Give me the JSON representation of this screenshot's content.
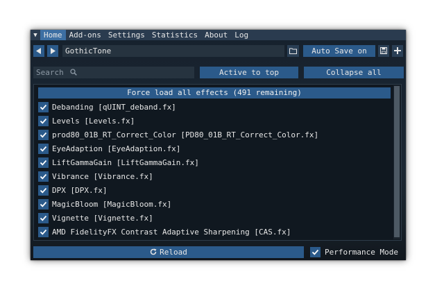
{
  "menu": {
    "items": [
      {
        "label": "Home",
        "active": true
      },
      {
        "label": "Add-ons",
        "active": false
      },
      {
        "label": "Settings",
        "active": false
      },
      {
        "label": "Statistics",
        "active": false
      },
      {
        "label": "About",
        "active": false
      },
      {
        "label": "Log",
        "active": false
      }
    ]
  },
  "preset": {
    "name": "GothicTone",
    "auto_save_label": "Auto Save on"
  },
  "toolbar": {
    "search_placeholder": "Search",
    "active_to_top_label": "Active to top",
    "collapse_all_label": "Collapse all"
  },
  "effects": {
    "force_load_label": "Force load all effects (491 remaining)",
    "items": [
      {
        "label": "Debanding [qUINT_deband.fx]",
        "checked": true
      },
      {
        "label": "Levels [Levels.fx]",
        "checked": true
      },
      {
        "label": "prod80_01B_RT_Correct_Color [PD80_01B_RT_Correct_Color.fx]",
        "checked": true
      },
      {
        "label": "EyeAdaption [EyeAdaption.fx]",
        "checked": true
      },
      {
        "label": "LiftGammaGain [LiftGammaGain.fx]",
        "checked": true
      },
      {
        "label": "Vibrance [Vibrance.fx]",
        "checked": true
      },
      {
        "label": "DPX [DPX.fx]",
        "checked": true
      },
      {
        "label": "MagicBloom [MagicBloom.fx]",
        "checked": true
      },
      {
        "label": "Vignette [Vignette.fx]",
        "checked": true
      },
      {
        "label": "AMD FidelityFX Contrast Adaptive Sharpening [CAS.fx]",
        "checked": true
      }
    ]
  },
  "footer": {
    "reload_label": "Reload",
    "performance_mode_label": "Performance Mode",
    "performance_mode_checked": true
  },
  "colors": {
    "accent": "#2b5a8a",
    "menubar": "#2a3b4f",
    "active_tab": "#3d6fa3"
  }
}
